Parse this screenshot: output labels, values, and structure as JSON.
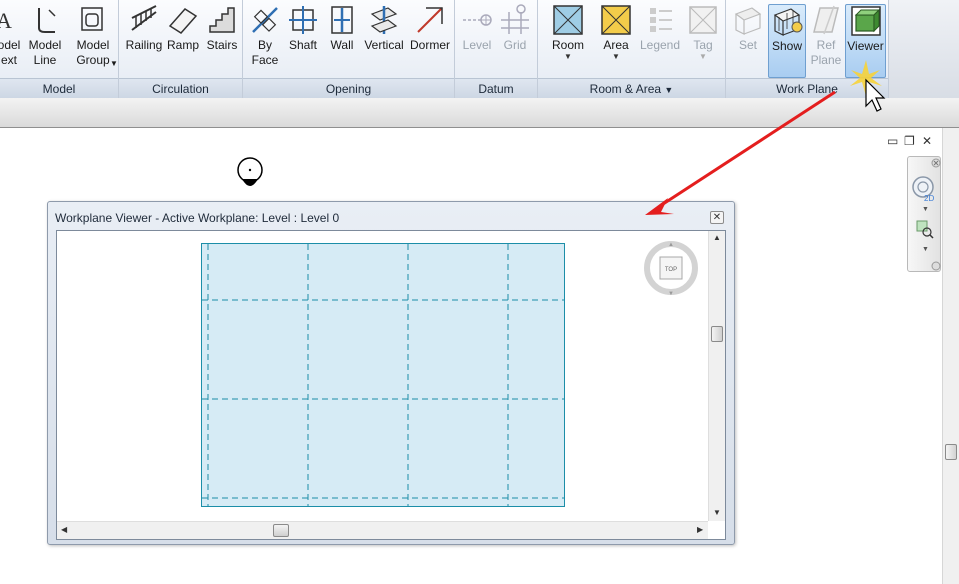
{
  "ribbon": {
    "panels": {
      "model": "Model",
      "circulation": "Circulation",
      "opening": "Opening",
      "datum": "Datum",
      "room_area": "Room & Area",
      "work_plane": "Work Plane"
    },
    "buttons": {
      "model_text": "odel\next",
      "model_line": "Model\nLine",
      "model_group": "Model\nGroup",
      "railing": "Railing",
      "ramp": "Ramp",
      "stairs": "Stairs",
      "by_face": "By\nFace",
      "shaft": "Shaft",
      "wall": "Wall",
      "vertical": "Vertical",
      "dormer": "Dormer",
      "level": "Level",
      "grid": "Grid",
      "room": "Room",
      "area": "Area",
      "legend": "Legend",
      "tag": "Tag",
      "set": "Set",
      "show": "Show",
      "ref_plane": "Ref\nPlane",
      "viewer": "Viewer"
    },
    "room_area_dropdown_glyph": "▼"
  },
  "viewer_dialog": {
    "title": "Workplane Viewer - Active Workplane: Level : Level 0",
    "close_glyph": "✕",
    "viewcube_face": "TOP"
  },
  "window_controls": {
    "minimize": "▭",
    "restore": "❐",
    "close": "✕"
  },
  "icons": [
    "model-text-icon",
    "model-line-icon",
    "model-group-icon",
    "railing-icon",
    "ramp-icon",
    "stairs-icon",
    "by-face-icon",
    "shaft-icon",
    "wall-opening-icon",
    "vertical-opening-icon",
    "dormer-icon",
    "level-icon",
    "grid-icon",
    "room-icon",
    "area-icon",
    "legend-icon",
    "tag-icon",
    "set-icon",
    "show-icon",
    "ref-plane-icon",
    "viewer-icon",
    "cursor-icon",
    "viewcube-icon",
    "steering-wheel-icon",
    "zoom-icon"
  ],
  "colors": {
    "workplane_fill": "#d6ebf5",
    "workplane_edge": "#1c8ea8",
    "active_button": "#a9cdf1",
    "annotation_arrow": "#e41e1e"
  }
}
